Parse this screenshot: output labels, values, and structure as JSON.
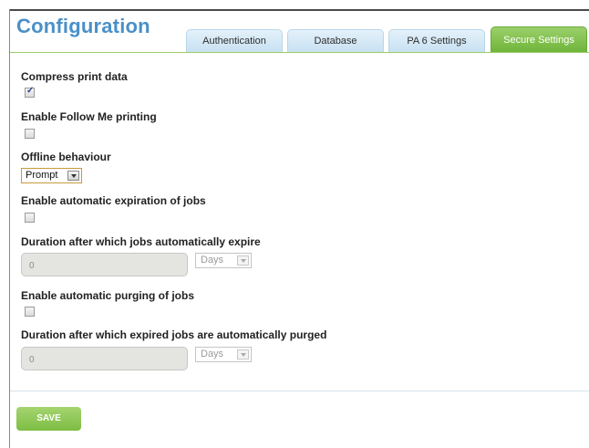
{
  "header": {
    "title": "Configuration"
  },
  "tabs": [
    {
      "label": "Authentication",
      "active": false
    },
    {
      "label": "Database",
      "active": false
    },
    {
      "label": "PA 6 Settings",
      "active": false
    },
    {
      "label": "Secure Settings",
      "active": true
    }
  ],
  "settings": {
    "compress": {
      "label": "Compress print data",
      "checked": true
    },
    "follow_me": {
      "label": "Enable Follow Me printing",
      "checked": false
    },
    "offline": {
      "label": "Offline behaviour",
      "value": "Prompt"
    },
    "expiration": {
      "label": "Enable automatic expiration of jobs",
      "checked": false
    },
    "expire_duration": {
      "label": "Duration after which jobs automatically expire",
      "value": "0",
      "unit": "Days"
    },
    "purging": {
      "label": "Enable automatic purging of jobs",
      "checked": false
    },
    "purge_duration": {
      "label": "Duration after which expired jobs are automatically purged",
      "value": "0",
      "unit": "Days"
    }
  },
  "actions": {
    "save_label": "SAVE"
  },
  "colors": {
    "accent_green": "#7dbd45",
    "title_blue": "#4a90c8",
    "tab_blue": "#c8e1f2"
  }
}
